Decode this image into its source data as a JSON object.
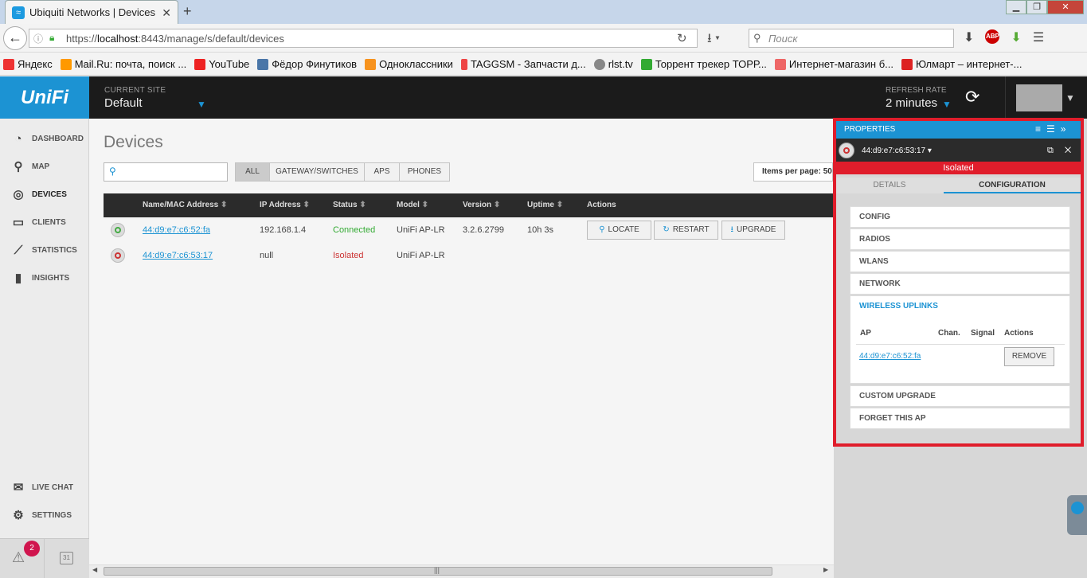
{
  "browser": {
    "tab_title": "Ubiquiti Networks | Devices",
    "url_prefix": "https://",
    "url_host": "localhost",
    "url_rest": ":8443/manage/s/default/devices",
    "search_placeholder": "Поиск",
    "bookmarks": [
      {
        "label": "Яндекс",
        "color": "#e33"
      },
      {
        "label": "Mail.Ru: почта, поиск ...",
        "color": "#f90"
      },
      {
        "label": "YouTube",
        "color": "#e22"
      },
      {
        "label": "Фёдор Финутиков",
        "color": "#4a76a8"
      },
      {
        "label": "Одноклассники",
        "color": "#f7931e"
      },
      {
        "label": "TAGGSM - Запчасти д...",
        "color": "#e44"
      },
      {
        "label": "rlst.tv",
        "color": "#888"
      },
      {
        "label": "Торрент трекер ТОРР...",
        "color": "#3a3"
      },
      {
        "label": "Интернет-магазин б...",
        "color": "#e66"
      },
      {
        "label": "Юлмарт – интернет-...",
        "color": "#d22"
      }
    ]
  },
  "header": {
    "logo": "UniFi",
    "current_site_label": "CURRENT SITE",
    "current_site_value": "Default",
    "refresh_label": "REFRESH RATE",
    "refresh_value": "2 minutes"
  },
  "sidebar": {
    "items": [
      {
        "label": "DASHBOARD",
        "icon": "◔"
      },
      {
        "label": "MAP",
        "icon": "⚲"
      },
      {
        "label": "DEVICES",
        "icon": "◎"
      },
      {
        "label": "CLIENTS",
        "icon": "▭"
      },
      {
        "label": "STATISTICS",
        "icon": "⟋"
      },
      {
        "label": "INSIGHTS",
        "icon": "▮"
      }
    ],
    "bottom_items": [
      {
        "label": "LIVE CHAT",
        "icon": "✉"
      },
      {
        "label": "SETTINGS",
        "icon": "⚙"
      }
    ],
    "alert_count": "2",
    "calendar_day": "31"
  },
  "main": {
    "title": "Devices",
    "filters": [
      "ALL",
      "GATEWAY/SWITCHES",
      "APS",
      "PHONES"
    ],
    "items_per_page": "Items per page: 50",
    "columns": [
      "Name/MAC Address",
      "IP Address",
      "Status",
      "Model",
      "Version",
      "Uptime",
      "Actions"
    ],
    "rows": [
      {
        "name": "44:d9:e7:c6:52:fa",
        "ip": "192.168.1.4",
        "status": "Connected",
        "model": "UniFi AP-LR",
        "version": "3.2.6.2799",
        "uptime": "10h 3s"
      },
      {
        "name": "44:d9:e7:c6:53:17",
        "ip": "null",
        "status": "Isolated",
        "model": "UniFi AP-LR",
        "version": "",
        "uptime": ""
      }
    ],
    "actions": [
      "LOCATE",
      "RESTART",
      "UPGRADE"
    ]
  },
  "properties": {
    "title": "PROPERTIES",
    "device_mac": "44:d9:e7:c6:53:17 ▾",
    "status": "Isolated",
    "tabs": [
      "DETAILS",
      "CONFIGURATION"
    ],
    "sections": [
      "CONFIG",
      "RADIOS",
      "WLANS",
      "NETWORK",
      "WIRELESS UPLINKS",
      "CUSTOM UPGRADE",
      "FORGET THIS AP"
    ],
    "uplink_headers": [
      "AP",
      "Chan.",
      "Signal",
      "Actions"
    ],
    "uplink_ap": "44:d9:e7:c6:52:fa",
    "remove_label": "REMOVE"
  },
  "colors": {
    "accent": "#1c93d3",
    "alert": "#e01d2b",
    "connected": "#3a3"
  }
}
